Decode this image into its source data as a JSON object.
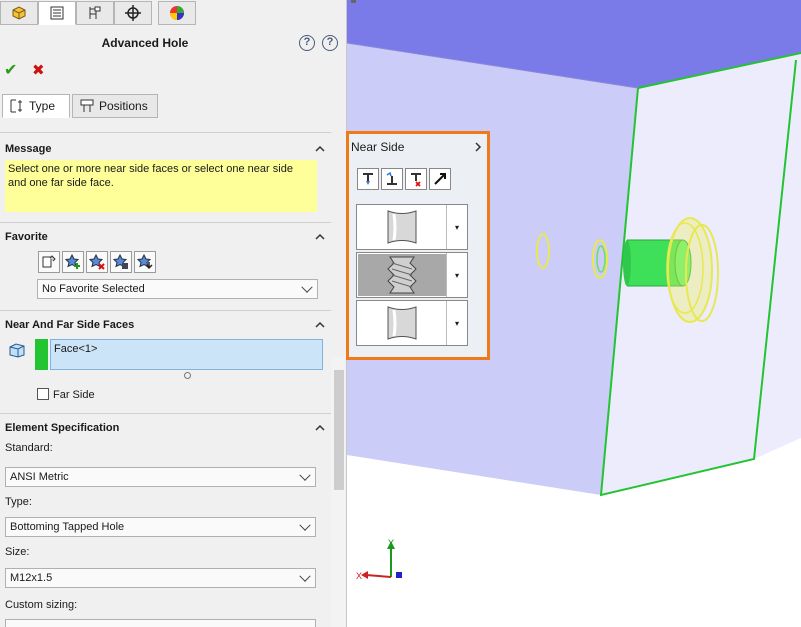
{
  "panel": {
    "title": "Advanced Hole",
    "tabs": {
      "type": "Type",
      "positions": "Positions"
    }
  },
  "message": {
    "header": "Message",
    "text": "Select one or more near side faces or select one near side and one far side face."
  },
  "favorite": {
    "header": "Favorite",
    "selected": "No Favorite Selected"
  },
  "faces": {
    "header": "Near And Far Side Faces",
    "selection": "Face<1>",
    "far_side_label": "Far Side",
    "far_side_checked": false,
    "selection_color": "#22c431"
  },
  "element_spec": {
    "header": "Element Specification",
    "standard_label": "Standard:",
    "standard_value": "ANSI Metric",
    "type_label": "Type:",
    "type_value": "Bottoming Tapped Hole",
    "size_label": "Size:",
    "size_value": "M12x1.5",
    "custom_label": "Custom sizing:"
  },
  "flyout": {
    "title": "Near Side",
    "accent": "#ee7a1a",
    "elements": [
      "counterbore-hole",
      "tapped-hole",
      "straight-hole"
    ],
    "selected_index": 1
  },
  "triad": {
    "x": "X",
    "y": "Y"
  },
  "colors": {
    "part_top": "#7a7ae8",
    "part_front": "#ccccf8",
    "part_side": "#ececfc",
    "edge": "#22c431",
    "preview_yellow": "#f2f25a"
  }
}
